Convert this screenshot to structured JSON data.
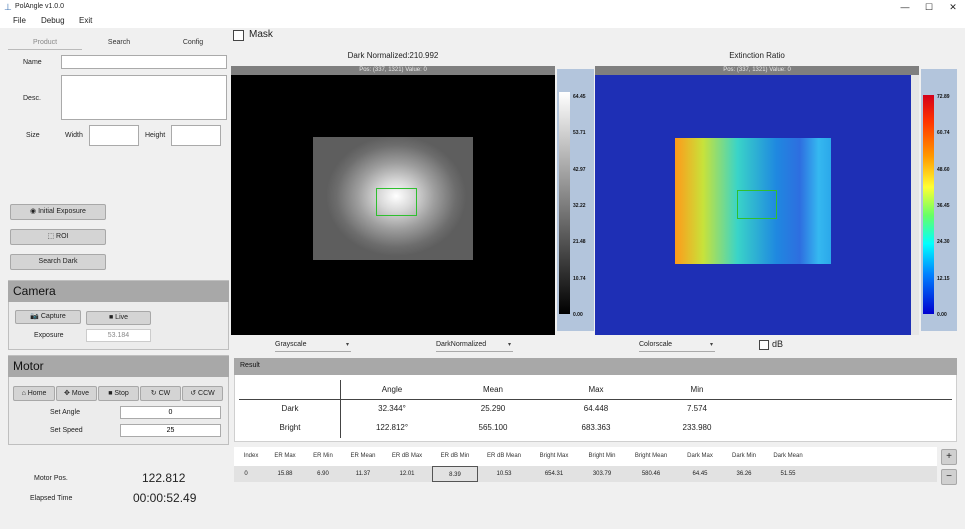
{
  "window": {
    "title": "PolAngle v1.0.0",
    "minimize_glyph": "—",
    "maximize_glyph": "☐",
    "close_glyph": "✕"
  },
  "menu": [
    "File",
    "Debug",
    "Exit"
  ],
  "tabs": [
    "Product",
    "Search",
    "Config"
  ],
  "product": {
    "name_label": "Name",
    "name_value": "",
    "desc_label": "Desc.",
    "desc_value": "",
    "size_label": "Size",
    "width_label": "Width",
    "width_value": "",
    "height_label": "Height",
    "height_value": ""
  },
  "actions": {
    "initial_exposure": "Initial Exposure",
    "roi": "ROI",
    "search_dark": "Search Dark"
  },
  "camera": {
    "title": "Camera",
    "capture": "Capture",
    "live": "Live",
    "exposure_label": "Exposure",
    "exposure_value": "53.184"
  },
  "motor": {
    "title": "Motor",
    "home": "Home",
    "move": "Move",
    "stop": "Stop",
    "cw": "CW",
    "ccw": "CCW",
    "set_angle_label": "Set Angle",
    "set_angle_value": "0",
    "set_speed_label": "Set Speed",
    "set_speed_value": "25"
  },
  "status": {
    "motor_pos_label": "Motor Pos.",
    "motor_pos_value": "122.812",
    "elapsed_label": "Elapsed Time",
    "elapsed_value": "00:00:52.49"
  },
  "mask": {
    "label": "Mask",
    "checked": false
  },
  "left_image": {
    "title": "Dark Normalized:210.992",
    "info": "Pos: (337, 1321)    Value: 0",
    "colorbar_ticks": [
      "64.45",
      "53.71",
      "42.97",
      "32.22",
      "21.48",
      "10.74",
      "0.00"
    ],
    "colorscale": "Grayscale",
    "mode": "DarkNormalized"
  },
  "right_image": {
    "title": "Extinction Ratio",
    "info": "Pos: (337, 1321)    Value: 0",
    "colorbar_ticks": [
      "72.89",
      "60.74",
      "48.60",
      "36.45",
      "24.30",
      "12.15",
      "0.00"
    ],
    "colorscale": "Colorscale",
    "db_label": "dB"
  },
  "result": {
    "title": "Result",
    "columns": [
      "",
      "Angle",
      "Mean",
      "Max",
      "Min"
    ],
    "rows": [
      {
        "name": "Dark",
        "angle": "32.344°",
        "mean": "25.290",
        "max": "64.448",
        "min": "7.574"
      },
      {
        "name": "Bright",
        "angle": "122.812°",
        "mean": "565.100",
        "max": "683.363",
        "min": "233.980"
      }
    ]
  },
  "grid": {
    "headers": [
      "Index",
      "ER Max",
      "ER Min",
      "ER Mean",
      "ER dB Max",
      "ER dB Min",
      "ER dB Mean",
      "Bright Max",
      "Bright Min",
      "Bright Mean",
      "Dark Max",
      "Dark Min",
      "Dark Mean"
    ],
    "rows": [
      [
        "0",
        "15.88",
        "6.90",
        "11.37",
        "12.01",
        "8.39",
        "10.53",
        "654.31",
        "303.79",
        "580.46",
        "64.45",
        "36.26",
        "51.55"
      ]
    ],
    "add": "+",
    "remove": "−"
  },
  "colors": {
    "accent_blue": "#1e2fb5",
    "panel_gray": "#a8a8a8",
    "colorbar_bg": "#b3c5dc"
  }
}
